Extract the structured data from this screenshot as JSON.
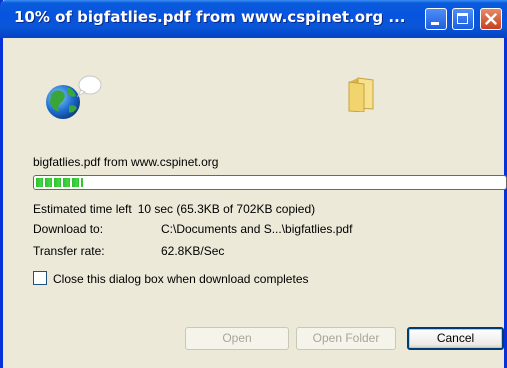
{
  "window": {
    "title": "10% of bigfatlies.pdf from www.cspinet.org ...",
    "titlebar_color": "#0A5BDB"
  },
  "titlebar_buttons": {
    "minimize_icon": "minimize-icon",
    "maximize_icon": "maximize-icon",
    "close_icon": "close-icon"
  },
  "icons": {
    "globe": "globe-icon",
    "folder": "folder-icon"
  },
  "download": {
    "source": "bigfatlies.pdf from www.cspinet.org",
    "progress_fraction": 0.1,
    "progress_color": "#2FBF2F",
    "estimated_label": "Estimated time left",
    "estimated_value": "10 sec (65.3KB of 702KB copied)",
    "download_to_label": "Download to:",
    "download_to_value": "C:\\Documents and S...\\bigfatlies.pdf",
    "transfer_rate_label": "Transfer rate:",
    "transfer_rate_value": "62.8KB/Sec"
  },
  "options": {
    "close_when_done_label": "Close this dialog box when download completes",
    "close_when_done_checked": false
  },
  "buttons": {
    "open_label": "Open",
    "open_folder_label": "Open Folder",
    "cancel_label": "Cancel"
  }
}
